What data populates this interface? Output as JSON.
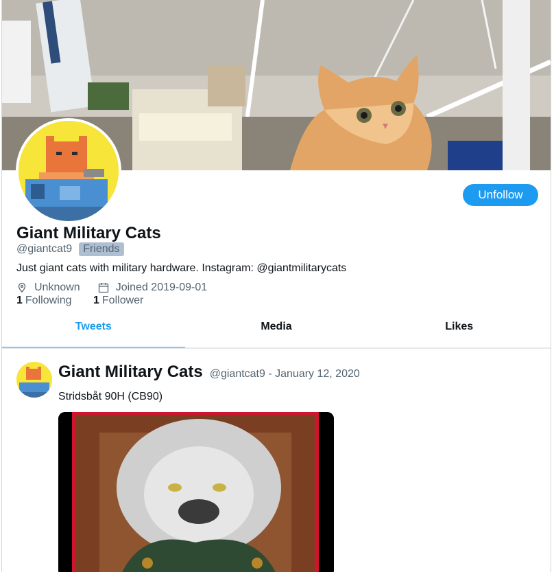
{
  "profile": {
    "name": "Giant Military Cats",
    "handle": "@giantcat9",
    "badge": "Friends",
    "bio": "Just giant cats with military hardware. Instagram: @giantmilitarycats",
    "location": "Unknown",
    "joined": "Joined 2019-09-01",
    "following_count": "1",
    "following_label": "Following",
    "follower_count": "1",
    "follower_label": "Follower",
    "follow_button": "Unfollow"
  },
  "icons": {
    "location": "location-pin-icon",
    "calendar": "calendar-icon"
  },
  "tabs": [
    {
      "label": "Tweets",
      "active": true
    },
    {
      "label": "Media",
      "active": false
    },
    {
      "label": "Likes",
      "active": false
    }
  ],
  "tweet": {
    "name": "Giant Military Cats",
    "handle": "@giantcat9",
    "separator": " - ",
    "date": "January 12, 2020",
    "text": "Stridsbåt 90H (CB90)"
  },
  "colors": {
    "accent": "#1d9bf0",
    "badge_bg": "#aebfd1",
    "muted": "#536471",
    "avatar_bg": "#f7e53a"
  }
}
